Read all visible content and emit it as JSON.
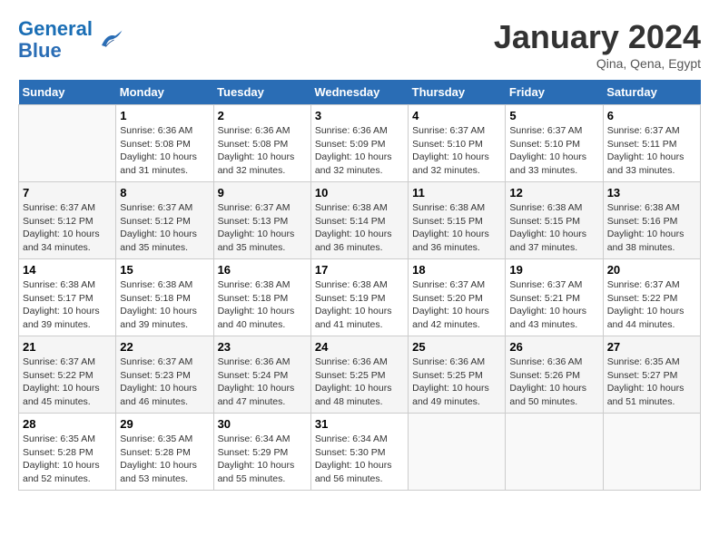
{
  "header": {
    "logo_line1": "General",
    "logo_line2": "Blue",
    "month_title": "January 2024",
    "location": "Qina, Qena, Egypt"
  },
  "calendar": {
    "days_of_week": [
      "Sunday",
      "Monday",
      "Tuesday",
      "Wednesday",
      "Thursday",
      "Friday",
      "Saturday"
    ],
    "weeks": [
      [
        {
          "day": "",
          "info": ""
        },
        {
          "day": "1",
          "info": "Sunrise: 6:36 AM\nSunset: 5:08 PM\nDaylight: 10 hours\nand 31 minutes."
        },
        {
          "day": "2",
          "info": "Sunrise: 6:36 AM\nSunset: 5:08 PM\nDaylight: 10 hours\nand 32 minutes."
        },
        {
          "day": "3",
          "info": "Sunrise: 6:36 AM\nSunset: 5:09 PM\nDaylight: 10 hours\nand 32 minutes."
        },
        {
          "day": "4",
          "info": "Sunrise: 6:37 AM\nSunset: 5:10 PM\nDaylight: 10 hours\nand 32 minutes."
        },
        {
          "day": "5",
          "info": "Sunrise: 6:37 AM\nSunset: 5:10 PM\nDaylight: 10 hours\nand 33 minutes."
        },
        {
          "day": "6",
          "info": "Sunrise: 6:37 AM\nSunset: 5:11 PM\nDaylight: 10 hours\nand 33 minutes."
        }
      ],
      [
        {
          "day": "7",
          "info": "Sunrise: 6:37 AM\nSunset: 5:12 PM\nDaylight: 10 hours\nand 34 minutes."
        },
        {
          "day": "8",
          "info": "Sunrise: 6:37 AM\nSunset: 5:12 PM\nDaylight: 10 hours\nand 35 minutes."
        },
        {
          "day": "9",
          "info": "Sunrise: 6:37 AM\nSunset: 5:13 PM\nDaylight: 10 hours\nand 35 minutes."
        },
        {
          "day": "10",
          "info": "Sunrise: 6:38 AM\nSunset: 5:14 PM\nDaylight: 10 hours\nand 36 minutes."
        },
        {
          "day": "11",
          "info": "Sunrise: 6:38 AM\nSunset: 5:15 PM\nDaylight: 10 hours\nand 36 minutes."
        },
        {
          "day": "12",
          "info": "Sunrise: 6:38 AM\nSunset: 5:15 PM\nDaylight: 10 hours\nand 37 minutes."
        },
        {
          "day": "13",
          "info": "Sunrise: 6:38 AM\nSunset: 5:16 PM\nDaylight: 10 hours\nand 38 minutes."
        }
      ],
      [
        {
          "day": "14",
          "info": "Sunrise: 6:38 AM\nSunset: 5:17 PM\nDaylight: 10 hours\nand 39 minutes."
        },
        {
          "day": "15",
          "info": "Sunrise: 6:38 AM\nSunset: 5:18 PM\nDaylight: 10 hours\nand 39 minutes."
        },
        {
          "day": "16",
          "info": "Sunrise: 6:38 AM\nSunset: 5:18 PM\nDaylight: 10 hours\nand 40 minutes."
        },
        {
          "day": "17",
          "info": "Sunrise: 6:38 AM\nSunset: 5:19 PM\nDaylight: 10 hours\nand 41 minutes."
        },
        {
          "day": "18",
          "info": "Sunrise: 6:37 AM\nSunset: 5:20 PM\nDaylight: 10 hours\nand 42 minutes."
        },
        {
          "day": "19",
          "info": "Sunrise: 6:37 AM\nSunset: 5:21 PM\nDaylight: 10 hours\nand 43 minutes."
        },
        {
          "day": "20",
          "info": "Sunrise: 6:37 AM\nSunset: 5:22 PM\nDaylight: 10 hours\nand 44 minutes."
        }
      ],
      [
        {
          "day": "21",
          "info": "Sunrise: 6:37 AM\nSunset: 5:22 PM\nDaylight: 10 hours\nand 45 minutes."
        },
        {
          "day": "22",
          "info": "Sunrise: 6:37 AM\nSunset: 5:23 PM\nDaylight: 10 hours\nand 46 minutes."
        },
        {
          "day": "23",
          "info": "Sunrise: 6:36 AM\nSunset: 5:24 PM\nDaylight: 10 hours\nand 47 minutes."
        },
        {
          "day": "24",
          "info": "Sunrise: 6:36 AM\nSunset: 5:25 PM\nDaylight: 10 hours\nand 48 minutes."
        },
        {
          "day": "25",
          "info": "Sunrise: 6:36 AM\nSunset: 5:25 PM\nDaylight: 10 hours\nand 49 minutes."
        },
        {
          "day": "26",
          "info": "Sunrise: 6:36 AM\nSunset: 5:26 PM\nDaylight: 10 hours\nand 50 minutes."
        },
        {
          "day": "27",
          "info": "Sunrise: 6:35 AM\nSunset: 5:27 PM\nDaylight: 10 hours\nand 51 minutes."
        }
      ],
      [
        {
          "day": "28",
          "info": "Sunrise: 6:35 AM\nSunset: 5:28 PM\nDaylight: 10 hours\nand 52 minutes."
        },
        {
          "day": "29",
          "info": "Sunrise: 6:35 AM\nSunset: 5:28 PM\nDaylight: 10 hours\nand 53 minutes."
        },
        {
          "day": "30",
          "info": "Sunrise: 6:34 AM\nSunset: 5:29 PM\nDaylight: 10 hours\nand 55 minutes."
        },
        {
          "day": "31",
          "info": "Sunrise: 6:34 AM\nSunset: 5:30 PM\nDaylight: 10 hours\nand 56 minutes."
        },
        {
          "day": "",
          "info": ""
        },
        {
          "day": "",
          "info": ""
        },
        {
          "day": "",
          "info": ""
        }
      ]
    ]
  }
}
